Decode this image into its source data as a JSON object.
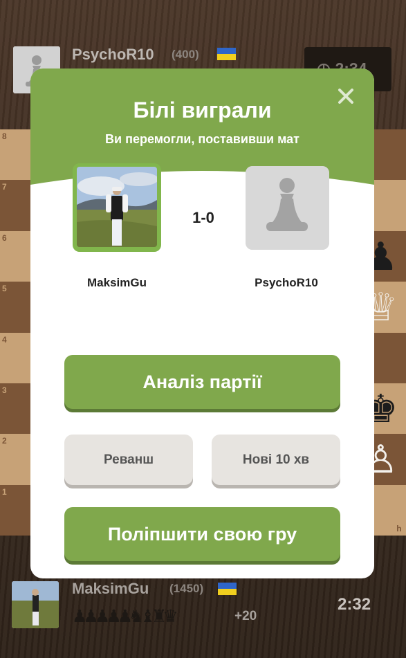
{
  "top_player": {
    "name": "PsychoR10",
    "rating": "(400)",
    "clock": "2:34",
    "flag_colors": [
      "#2f66c9",
      "#f1cf1f"
    ]
  },
  "bottom_player": {
    "name": "MaksimGu",
    "rating": "(1450)",
    "clock": "2:32",
    "captured": "♟♟♟♟♟♞♝♜♛",
    "advantage": "+20"
  },
  "board": {
    "ranks": [
      "8",
      "7",
      "6",
      "5",
      "4",
      "3",
      "2",
      "1"
    ],
    "file_label": "h",
    "colors": {
      "light": "#c7a277",
      "dark": "#7b5537"
    }
  },
  "modal": {
    "title": "Білі виграли",
    "subtitle": "Ви перемогли, поставивши мат",
    "score": "1-0",
    "winner_name": "MaksimGu",
    "loser_name": "PsychoR10",
    "close_icon": "close-icon",
    "accent_color": "#80a84c",
    "buttons": {
      "analysis": "Аналіз партії",
      "rematch": "Реванш",
      "new_game": "Нові 10 хв",
      "improve": "Поліпшити свою гру"
    }
  }
}
